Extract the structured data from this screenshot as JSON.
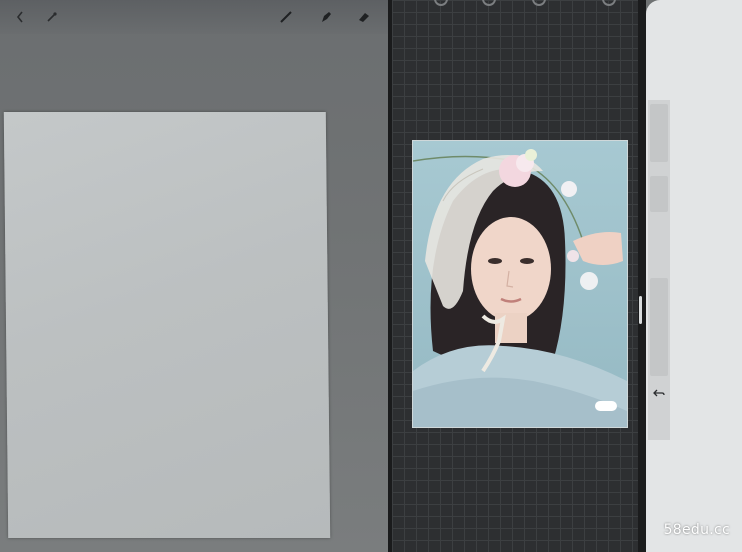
{
  "left_app": {
    "toolbar_icons": [
      "undo-arrow-icon",
      "pin-icon",
      "brush-icon",
      "smudge-icon",
      "eraser-icon"
    ]
  },
  "middle_app": {
    "photo_badge": "",
    "photo_caption": ""
  },
  "right_app": {
    "icons": [
      "square-icon",
      "undo-icon"
    ]
  },
  "watermark": "58edu.cc"
}
